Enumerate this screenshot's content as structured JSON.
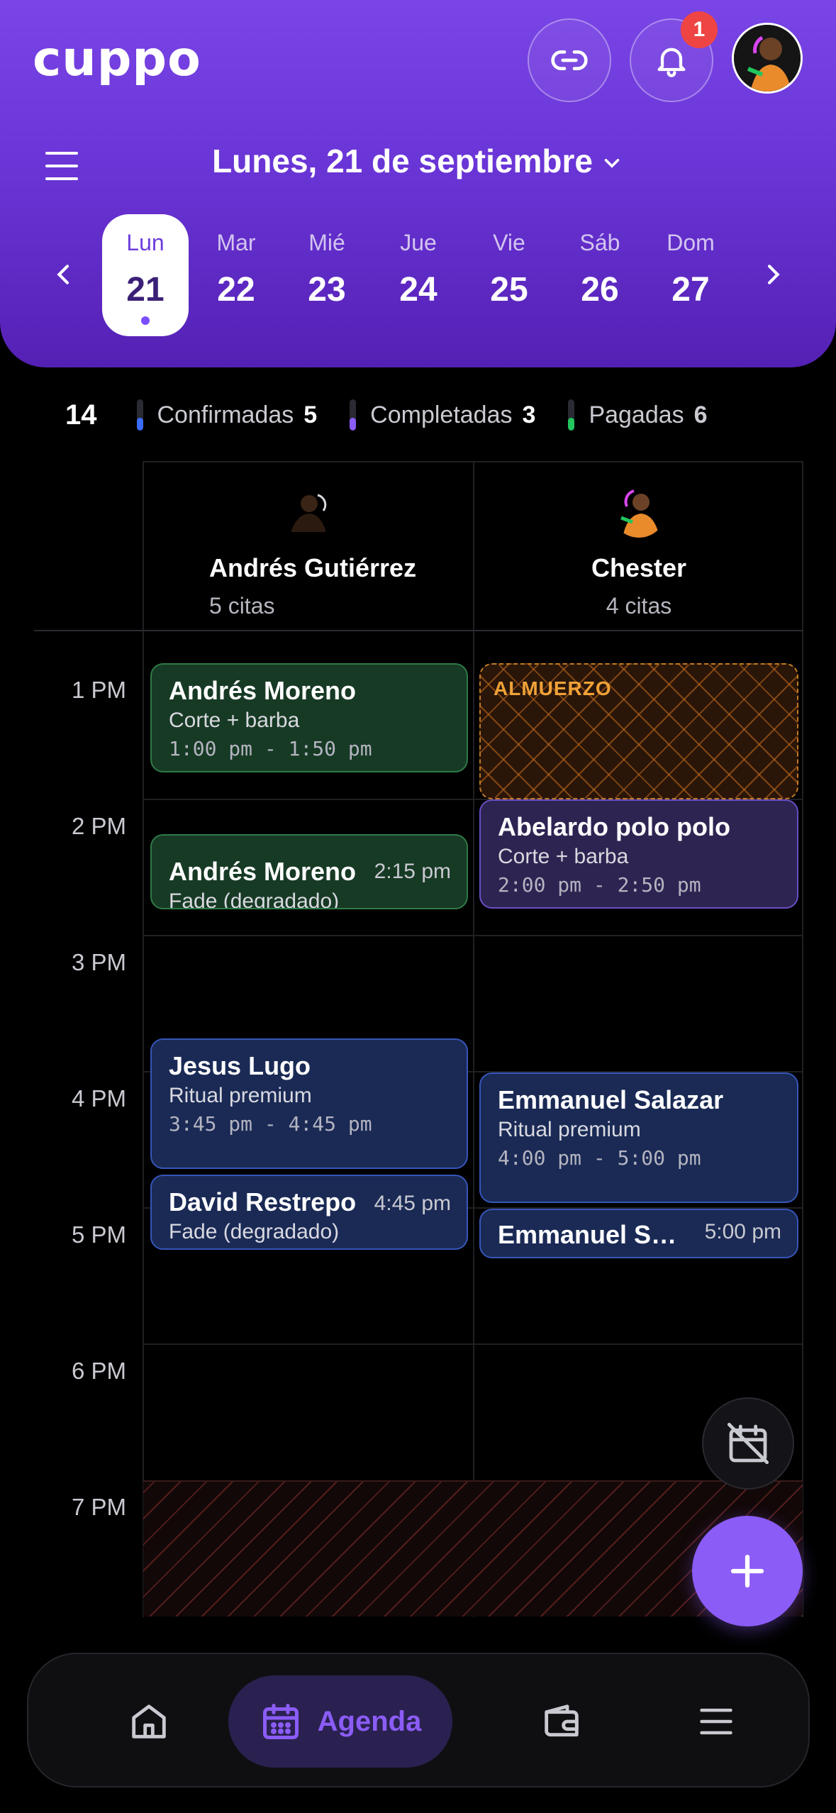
{
  "header": {
    "logo": "cuppo",
    "notifications_count": "1",
    "date_title": "Lunes, 21 de septiembre"
  },
  "week": [
    {
      "name": "Lun",
      "num": "21",
      "selected": true
    },
    {
      "name": "Mar",
      "num": "22"
    },
    {
      "name": "Mié",
      "num": "23"
    },
    {
      "name": "Jue",
      "num": "24"
    },
    {
      "name": "Vie",
      "num": "25"
    },
    {
      "name": "Sáb",
      "num": "26"
    },
    {
      "name": "Dom",
      "num": "27"
    }
  ],
  "summary": {
    "total": "14",
    "confirmed": {
      "label": "Confirmadas",
      "count": "5",
      "color": "#3b6cf6"
    },
    "completed": {
      "label": "Completadas",
      "count": "3",
      "color": "#8b5cf6"
    },
    "paid": {
      "label": "Pagadas",
      "count": "6",
      "color": "#22c55e"
    }
  },
  "staff": [
    {
      "name": "Andrés Gutiérrez",
      "count": "5 citas"
    },
    {
      "name": "Chester",
      "count": "4 citas"
    }
  ],
  "hours": [
    "1 PM",
    "2 PM",
    "3 PM",
    "4 PM",
    "5 PM",
    "6 PM",
    "7 PM"
  ],
  "lunch_label": "ALMUERZO",
  "appointments": {
    "a1": {
      "client": "Andrés Moreno",
      "service": "Corte + barba",
      "time": "1:00 pm - 1:50 pm"
    },
    "a2": {
      "client": "Andrés Moreno",
      "service": "Fade (degradado)",
      "time_short": "2:15 pm"
    },
    "a3": {
      "client": "Jesus Lugo",
      "service": "Ritual premium",
      "time": "3:45 pm - 4:45 pm"
    },
    "a4": {
      "client": "David Restrepo",
      "service": "Fade (degradado)",
      "time_short": "4:45 pm"
    },
    "c1": {
      "client": "Abelardo polo polo",
      "service": "Corte + barba",
      "time": "2:00 pm - 2:50 pm"
    },
    "c2": {
      "client": "Emmanuel Salazar",
      "service": "Ritual premium",
      "time": "4:00 pm - 5:00 pm"
    },
    "c3": {
      "client": "Emmanuel Sal...",
      "time_short": "5:00 pm"
    }
  },
  "nav": {
    "agenda_label": "Agenda"
  }
}
